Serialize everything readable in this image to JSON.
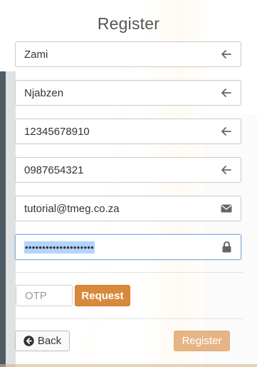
{
  "form": {
    "title": "Register",
    "fields": [
      {
        "value": "Zami",
        "icon": "arrow-left-icon"
      },
      {
        "value": "Njabzen",
        "icon": "arrow-left-icon"
      },
      {
        "value": "12345678910",
        "icon": "arrow-left-icon"
      },
      {
        "value": "0987654321",
        "icon": "arrow-left-icon"
      },
      {
        "value": "tutorial@tmeg.co.za",
        "icon": "envelope-icon"
      },
      {
        "value": "••••••••••••••••••••",
        "icon": "lock-icon"
      }
    ],
    "otp": {
      "placeholder": "OTP",
      "value": ""
    },
    "request_label": "Request",
    "back_label": "Back",
    "register_label": "Register"
  },
  "colors": {
    "accent": "#d88a3a",
    "accent_disabled": "#e6b586",
    "focus_border": "#7fb0e3",
    "selection": "#b3d4fc"
  }
}
